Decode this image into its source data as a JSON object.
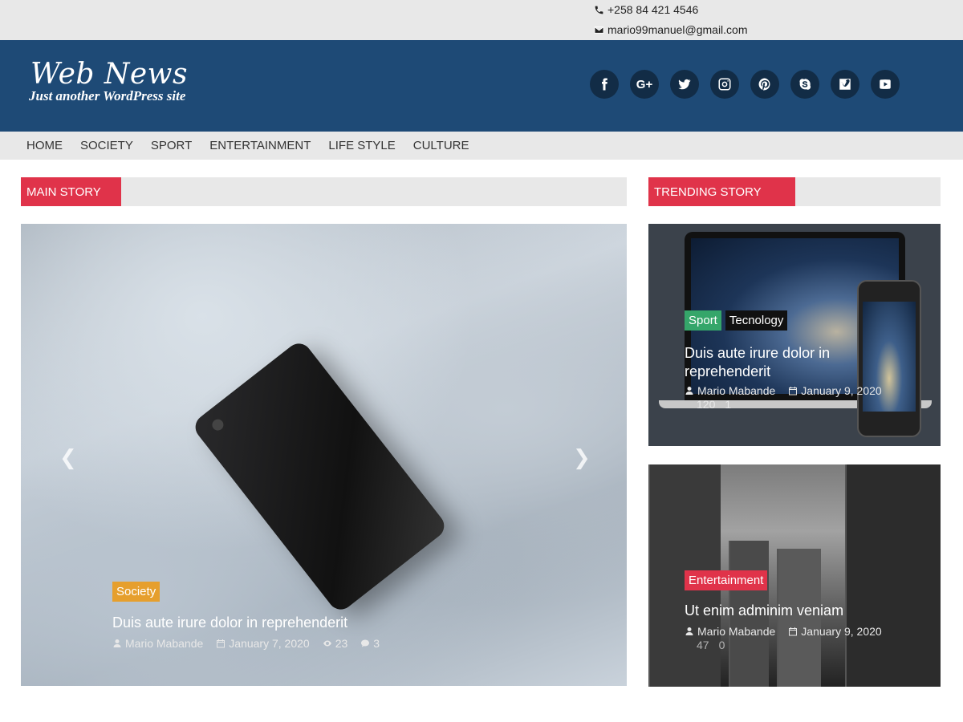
{
  "contact": {
    "phone": "+258 84 421 4546",
    "email": "mario99manuel@gmail.com"
  },
  "header": {
    "title": "Web News",
    "tagline": "Just another WordPress site",
    "socials": [
      "facebook-icon",
      "google-plus-icon",
      "twitter-icon",
      "instagram-icon",
      "pinterest-icon",
      "skype-icon",
      "vimeo-icon",
      "youtube-icon"
    ]
  },
  "nav": {
    "items": [
      "HOME",
      "SOCIETY",
      "SPORT",
      "ENTERTAINMENT",
      "LIFE STYLE",
      "CULTURE"
    ]
  },
  "main": {
    "section_label": "MAIN STORY",
    "tag": "Society",
    "title": "Duis aute irure dolor in reprehenderit",
    "author": "Mario Mabande",
    "date": "January 7, 2020",
    "views": "23",
    "comments": "3"
  },
  "trending": {
    "section_label": "TRENDING STORY",
    "items": [
      {
        "tags": [
          "Sport",
          "Tecnology"
        ],
        "title": "Duis aute irure dolor in reprehenderit",
        "author": "Mario Mabande",
        "date": "January 9, 2020",
        "views": "120",
        "comments": "1"
      },
      {
        "tags": [
          "Entertainment"
        ],
        "title": "Ut enim adminim veniam",
        "author": "Mario Mabande",
        "date": "January 9, 2020",
        "views": "47",
        "comments": "0"
      }
    ]
  },
  "colors": {
    "header_bg": "#1e4a76",
    "accent_red": "#e0334a",
    "tag_society": "#e69f2d",
    "tag_sport": "#35a66a"
  }
}
